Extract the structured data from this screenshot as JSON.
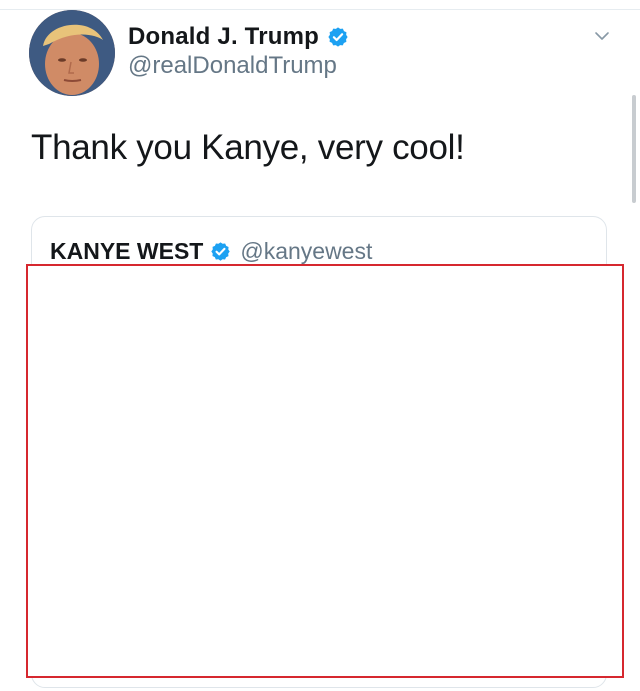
{
  "tweet": {
    "author": {
      "display_name": "Donald J. Trump",
      "handle": "@realDonaldTrump",
      "verified_icon": "verified-badge-icon",
      "avatar_icon": "avatar-icon"
    },
    "menu_icon": "chevron-down-icon",
    "text": "Thank you Kanye, very cool!",
    "quoted_tweet": {
      "display_name": "KANYE WEST",
      "handle": "@kanyewest",
      "verified_icon": "verified-badge-icon",
      "content_redacted": true
    }
  },
  "colors": {
    "text_primary": "#14171a",
    "text_secondary": "#657786",
    "verified_blue": "#1da1f2",
    "card_border": "#dfe5ea",
    "redaction_border": "#d6282f"
  }
}
